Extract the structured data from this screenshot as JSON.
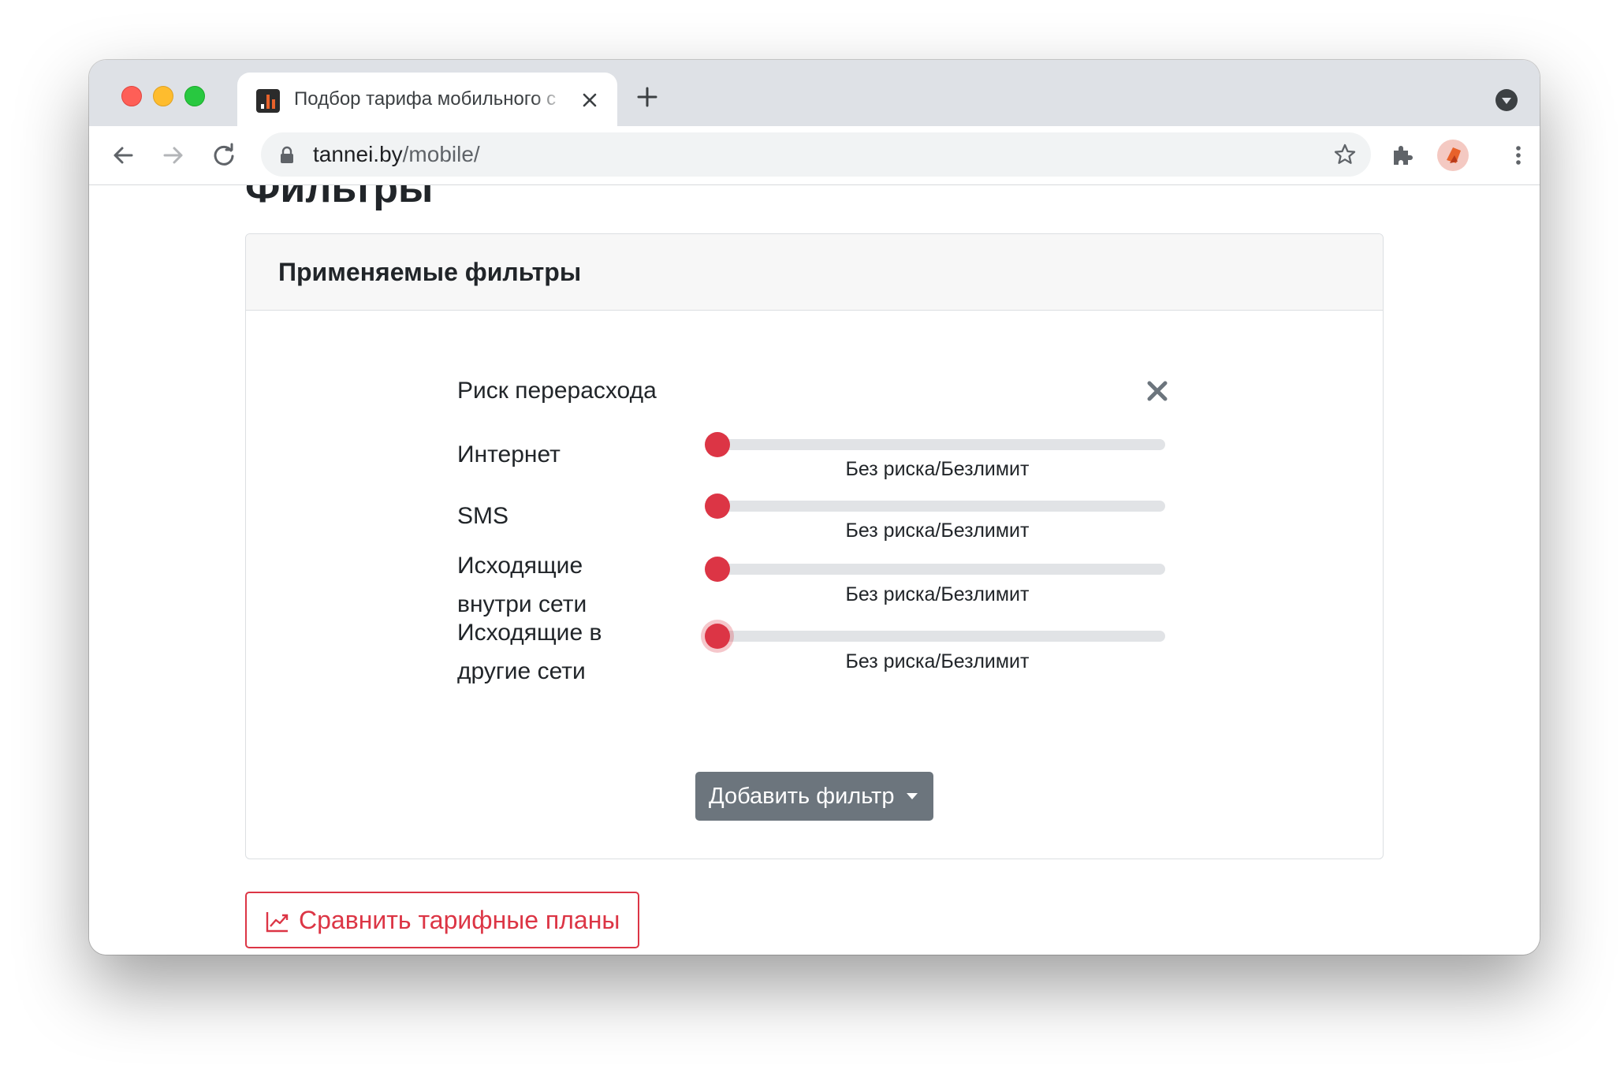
{
  "browser": {
    "tab_title": "Подбор тарифа мобильного с",
    "url_host": "tannei.by",
    "url_path": "/mobile/"
  },
  "page": {
    "title": "Фильтры",
    "card_header": "Применяемые фильтры",
    "risk_group_title": "Риск перерасхода",
    "filters": [
      {
        "label": "Интернет",
        "value_label": "Без риска/Безлимит",
        "level": 0
      },
      {
        "label": "SMS",
        "value_label": "Без риска/Безлимит",
        "level": 0
      },
      {
        "label": "Исходящие внутри сети",
        "value_label": "Без риска/Безлимит",
        "level": 0
      },
      {
        "label": "Исходящие в другие сети",
        "value_label": "Без риска/Безлимит",
        "level": 0
      }
    ],
    "add_filter_label": "Добавить фильтр",
    "compare_label": "Сравнить тарифные планы"
  },
  "colors": {
    "accent_red": "#dc3545",
    "secondary_button": "#6c757d",
    "slider_track": "#e1e3e6"
  },
  "icons": [
    "back-arrow-icon",
    "forward-arrow-icon",
    "reload-icon",
    "lock-icon",
    "star-icon",
    "puzzle-icon",
    "more-vert-icon",
    "close-icon",
    "chevron-down-icon",
    "chart-line-icon"
  ]
}
